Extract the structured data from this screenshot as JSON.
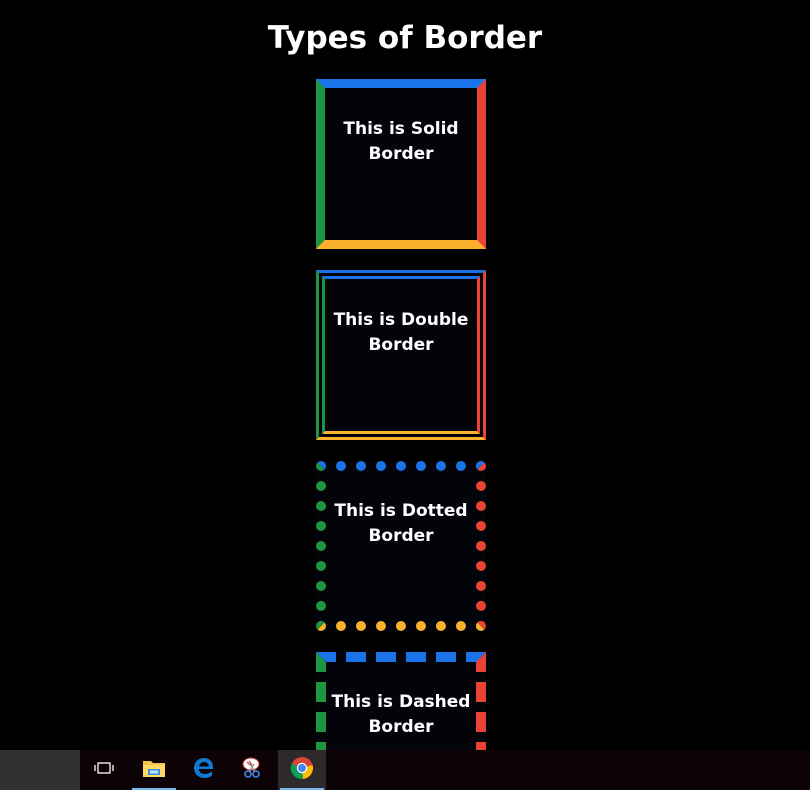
{
  "page": {
    "title": "Types of Border"
  },
  "boxes": [
    {
      "style": "solid",
      "label": "This is Solid Border"
    },
    {
      "style": "double",
      "label": "This is Double Border"
    },
    {
      "style": "dotted",
      "label": "This is Dotted Border"
    },
    {
      "style": "dashed",
      "label": "This is Dashed Border"
    }
  ],
  "colors": {
    "background": "#000000",
    "border_top": "#1a73e8",
    "border_right": "#ea4335",
    "border_bottom": "#fbb02e",
    "border_left": "#1e9641",
    "text": "#ffffff"
  },
  "taskbar": {
    "items": [
      {
        "icon": "task-view-icon"
      },
      {
        "icon": "file-explorer-icon",
        "running": true
      },
      {
        "icon": "edge-browser-icon"
      },
      {
        "icon": "snipping-tool-icon"
      },
      {
        "icon": "chrome-icon",
        "running": true,
        "focused": true
      }
    ]
  }
}
